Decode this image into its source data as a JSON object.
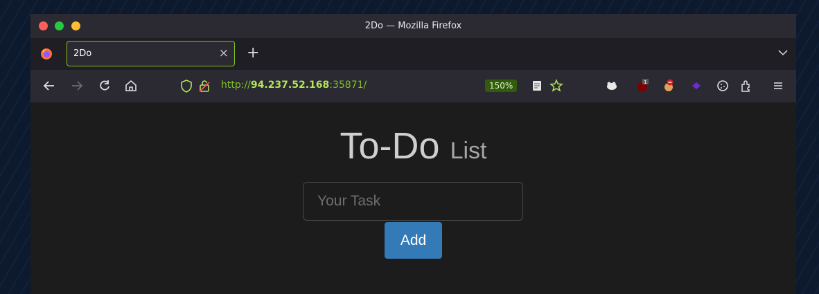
{
  "window": {
    "title": "2Do — Mozilla Firefox",
    "traffic_colors": [
      "#ff5f57",
      "#28c840",
      "#febc2e"
    ]
  },
  "tabs": [
    {
      "title": "2Do",
      "active": true
    }
  ],
  "new_tab_label": "+",
  "navbar": {
    "url_scheme": "http://",
    "url_host": "94.237.52.168",
    "url_rest": ":35871/",
    "zoom": "150%",
    "extension_badge": "1"
  },
  "page": {
    "heading_main": "To-Do",
    "heading_sub": "List",
    "task_placeholder": "Your Task",
    "add_label": "Add"
  },
  "colors": {
    "accent": "#7fc31f",
    "button": "#337ab7"
  }
}
